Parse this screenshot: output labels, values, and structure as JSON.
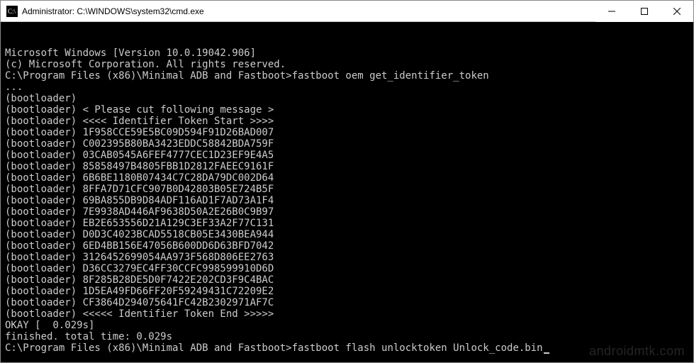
{
  "window": {
    "title": "Administrator: C:\\WINDOWS\\system32\\cmd.exe"
  },
  "terminal": {
    "banner": [
      "Microsoft Windows [Version 10.0.19042.906]",
      "(c) Microsoft Corporation. All rights reserved.",
      ""
    ],
    "prompt1": "C:\\Program Files (x86)\\Minimal ADB and Fastboot>",
    "command1": "fastboot oem get_identifier_token",
    "output": [
      "...",
      "(bootloader)",
      "(bootloader) < Please cut following message >",
      "(bootloader) <<<< Identifier Token Start >>>>",
      "(bootloader) 1F958CCE59E5BC09D594F91D26BAD007",
      "(bootloader) C002395B80BA3423EDDC58842BDA759F",
      "(bootloader) 03CAB0545A6FEF4777CEC1D23EF9E4A5",
      "(bootloader) 85858497B4805FBB1D2812FAEEC9161F",
      "(bootloader) 6B6BE1180B07434C7C28DA79DC002D64",
      "(bootloader) 8FFA7D71CFC907B0D42803B05E724B5F",
      "(bootloader) 69BA855DB9D84ADF116AD1F7AD73A1F4",
      "(bootloader) 7E9938AD446AF9638D50A2E26B0C9B97",
      "(bootloader) EB2E653556D21A129C3EF33A2F77C131",
      "(bootloader) D0D3C4023BCAD5518CB05E3430BEA944",
      "(bootloader) 6ED4BB156E47056B600DD6D63BFD7042",
      "(bootloader) 3126452699054AA973F568D806EE2763",
      "(bootloader) D36CC3279EC4FF30CCFC998599910D6D",
      "(bootloader) 8F285B28DE5D0F7422E202CD3F9C4BAC",
      "(bootloader) 1D5EA49FD66FF20F59249431C72209E2",
      "(bootloader) CF3864D294075641FC42B2302971AF7C",
      "(bootloader) <<<<< Identifier Token End >>>>>",
      "OKAY [  0.029s]",
      "finished. total time: 0.029s",
      ""
    ],
    "prompt2": "C:\\Program Files (x86)\\Minimal ADB and Fastboot>",
    "command2": "fastboot flash unlocktoken Unlock_code.bin"
  },
  "watermark": "androidmtk.com"
}
